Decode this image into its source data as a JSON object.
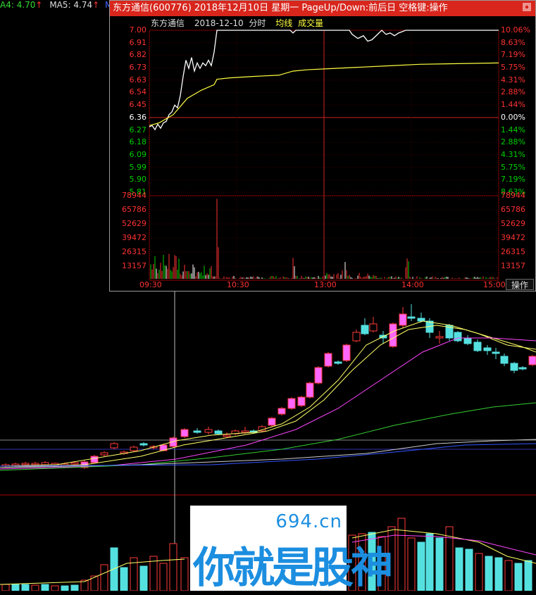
{
  "topbar": {
    "ma4_label": "A4: 4.70",
    "ma4_arrow": "↑",
    "ma5_label": "MA5: 4.74",
    "ma5_arrow": "↑",
    "ma10_label": "MA"
  },
  "popup": {
    "title": "东方通信(600776)  2018年12月10日  星期一  PageUp/Down:前后日  空格键:操作",
    "close_icon": "restore-icon",
    "subheader": {
      "name": "东方通信",
      "date": "2018-12-10",
      "mode": "分时",
      "avg_label": "均线",
      "vol_label": "成交量"
    },
    "price_axis_left": [
      "7.00",
      "6.91",
      "6.82",
      "6.73",
      "6.63",
      "6.54",
      "6.45",
      "6.36",
      "6.27",
      "6.18",
      "6.09",
      "5.99",
      "5.90",
      "5.81"
    ],
    "price_axis_right": [
      "10.06%",
      "8.63%",
      "7.19%",
      "5.75%",
      "4.31%",
      "2.88%",
      "1.44%",
      "0.00%",
      "1.44%",
      "2.88%",
      "4.31%",
      "5.75%",
      "7.19%",
      "8.63%"
    ],
    "volume_axis_left": [
      "78944",
      "65786",
      "52629",
      "39472",
      "26315",
      "13157"
    ],
    "volume_axis_right": [
      "78944",
      "65786",
      "52629",
      "39472",
      "26315",
      "13157"
    ],
    "time_axis": [
      "09:30",
      "10:30",
      "13:00",
      "14:00",
      "15:00"
    ],
    "operate_button": "操作",
    "colors": {
      "up": "#ff3232",
      "down": "#00d000",
      "avg": "#ffff40",
      "price_line": "#ffffff",
      "border": "#a00000",
      "title_bg": "#d8261d"
    }
  },
  "watermark": {
    "domain": "694.cn",
    "text": "你就是股神"
  },
  "colors": {
    "up_candle": "#ff3a3a",
    "up_candle_fill": "#ff66ff",
    "down_candle": "#55e0e0",
    "ma_yellow": "#ffff66",
    "ma_magenta": "#ff44ff",
    "ma_green": "#33cc33",
    "ma_blue": "#3355ff",
    "ma_white": "#cccccc"
  }
}
